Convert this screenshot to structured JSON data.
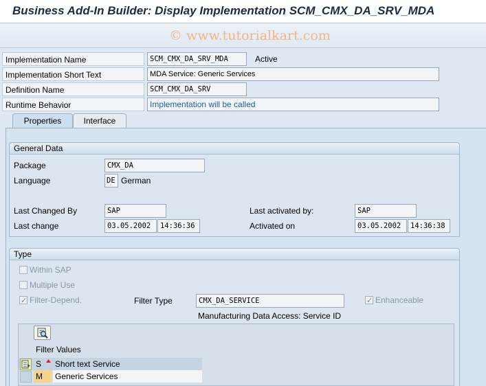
{
  "window": {
    "title": "Business Add-In Builder: Display Implementation SCM_CMX_DA_SRV_MDA"
  },
  "toolbar": {
    "watermark": "© www.tutorialkart.com"
  },
  "header_fields": {
    "impl_name_label": "Implementation Name",
    "impl_name_value": "SCM_CMX_DA_SRV_MDA",
    "impl_status": "Active",
    "short_text_label": "Implementation Short Text",
    "short_text_value": "MDA Service: Generic Services",
    "def_name_label": "Definition Name",
    "def_name_value": "SCM_CMX_DA_SRV",
    "runtime_label": "Runtime Behavior",
    "runtime_value": "Implementation will be called"
  },
  "tabs": [
    {
      "label": "Properties",
      "active": true
    },
    {
      "label": "Interface",
      "active": false
    }
  ],
  "general_data": {
    "title": "General Data",
    "package_label": "Package",
    "package_value": "CMX_DA",
    "language_label": "Language",
    "language_code": "DE",
    "language_name": "German",
    "last_changed_by_label": "Last Changed By",
    "last_changed_by_value": "SAP",
    "last_change_label": "Last change",
    "last_change_date": "03.05.2002",
    "last_change_time": "14:36:36",
    "last_activated_by_label": "Last activated by:",
    "last_activated_by_value": "SAP",
    "activated_on_label": "Activated on",
    "activated_on_date": "03.05.2002",
    "activated_on_time": "14:36:38"
  },
  "type_group": {
    "title": "Type",
    "within_sap_label": "Within SAP",
    "within_sap_checked": false,
    "multiple_use_label": "Multiple Use",
    "multiple_use_checked": false,
    "filter_depend_label": "Filter-Depend.",
    "filter_depend_checked": true,
    "filter_type_label": "Filter Type",
    "filter_type_value": "CMX_DA_SERVICE",
    "filter_type_desc": "Manufacturing Data Access: Service ID",
    "enhanceable_label": "Enhanceable",
    "enhanceable_checked": true
  },
  "filter_values": {
    "title": "Filter Values",
    "columns": [
      "S",
      "Short text Service"
    ],
    "rows": [
      {
        "code": "M",
        "text": "Generic Services"
      }
    ]
  },
  "colors": {
    "accent": "#1d5ea6",
    "background": "#dfe9f3",
    "watermark": "#f2b58a"
  },
  "icons": [
    "select-all-icon",
    "sort-up-icon",
    "detail-icon"
  ]
}
